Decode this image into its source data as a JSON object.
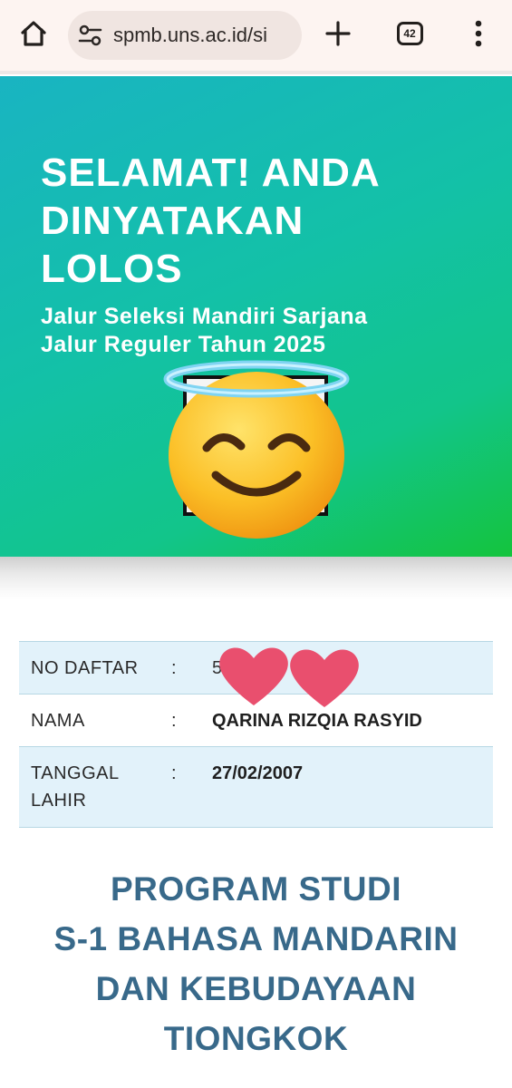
{
  "browser": {
    "url": "spmb.uns.ac.id/si",
    "tab_count": "42"
  },
  "banner": {
    "headline_lines": [
      "SELAMAT! ANDA",
      "DINYATAKAN",
      "LOLOS"
    ],
    "subline_lines": [
      "Jalur Seleksi Mandiri Sarjana",
      "Jalur Reguler Tahun 2025"
    ],
    "emoji": "smiling-face-with-halo"
  },
  "info": {
    "rows": [
      {
        "label": "NO DAFTAR",
        "separator": ":",
        "value": "5"
      },
      {
        "label": "NAMA",
        "separator": ":",
        "value": "QARINA RIZQIA RASYID"
      },
      {
        "label": "TANGGAL LAHIR",
        "separator": ":",
        "value": "27/02/2007"
      }
    ]
  },
  "program": {
    "lines": [
      "PROGRAM STUDI",
      "S-1 BAHASA MANDARIN",
      "DAN KEBUDAYAAN",
      "TIONGKOK"
    ]
  },
  "colors": {
    "banner_start": "#19b4c2",
    "banner_end": "#14c43d",
    "row_alt_bg": "#e2f2fa",
    "program_text": "#38698a"
  }
}
